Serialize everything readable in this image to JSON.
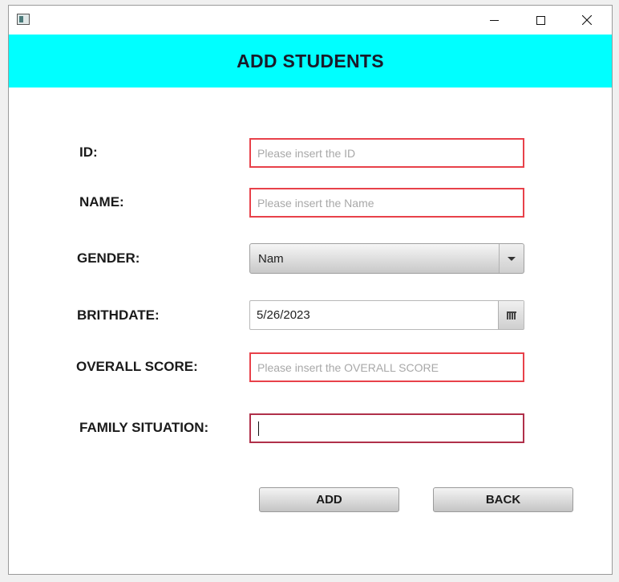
{
  "window": {
    "title": "",
    "controls": {
      "minimize": "minimize-icon",
      "maximize": "maximize-icon",
      "close": "close-icon"
    }
  },
  "header": {
    "title": "ADD STUDENTS",
    "background": "#00ffff"
  },
  "form": {
    "id": {
      "label": "ID:",
      "placeholder": "Please insert the ID",
      "value": ""
    },
    "name": {
      "label": "NAME:",
      "placeholder": "Please insert the Name",
      "value": ""
    },
    "gender": {
      "label": "GENDER:",
      "value": "Nam"
    },
    "birthdate": {
      "label": "BRITHDATE:",
      "value": "5/26/2023"
    },
    "overall_score": {
      "label": "OVERALL SCORE:",
      "placeholder": "Please insert the OVERALL SCORE",
      "value": ""
    },
    "family_situation": {
      "label": "FAMILY SITUATION:",
      "value": ""
    }
  },
  "buttons": {
    "add": "ADD",
    "back": "BACK"
  },
  "colors": {
    "error_border": "#e8414a",
    "focus_border": "#b0304a"
  }
}
